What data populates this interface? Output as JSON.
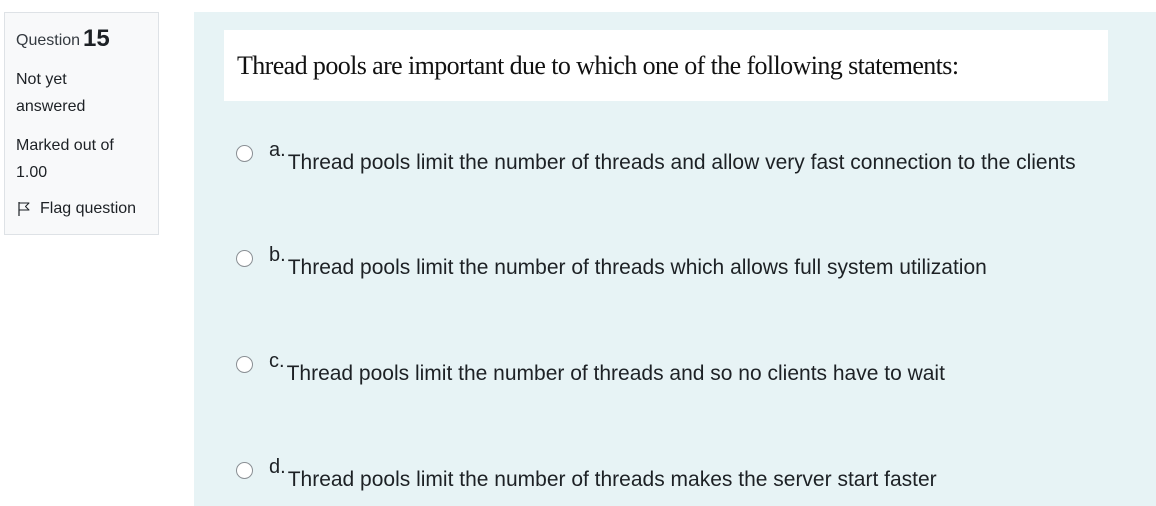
{
  "info": {
    "question_label": "Question",
    "question_number": "15",
    "state_line1": "Not yet",
    "state_line2": "answered",
    "grade_line1": "Marked out of",
    "grade_line2": "1.00",
    "flag_label": "Flag question"
  },
  "question": {
    "text": "Thread pools are important due to which one of the following statements:"
  },
  "options": [
    {
      "letter": "a.",
      "text": "Thread pools limit the number of threads and allow very fast connection to the clients"
    },
    {
      "letter": "b.",
      "text": "Thread pools limit the number of threads which allows full system utilization"
    },
    {
      "letter": "c.",
      "text": "Thread pools limit the number of threads and so no clients have to wait"
    },
    {
      "letter": "d.",
      "text": "Thread pools limit the number of threads makes the server start faster"
    }
  ],
  "icons": {
    "flag": "flag-outline-icon"
  },
  "colors": {
    "panel_bg": "#f8f9fa",
    "content_bg": "#e7f3f5",
    "text": "#1d2125"
  }
}
